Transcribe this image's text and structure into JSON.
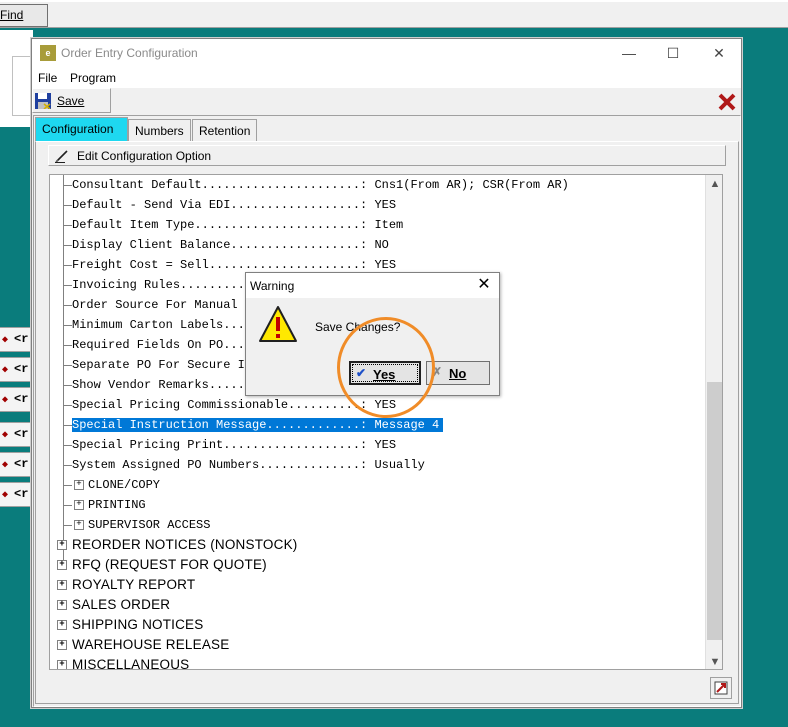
{
  "background_app": {
    "find_label": "Find",
    "side_button_label": "<r"
  },
  "window": {
    "title": "Order Entry Configuration",
    "icon_text": "e",
    "controls": {
      "minimize": "—",
      "maximize": "☐",
      "close": "✕"
    },
    "menu": [
      "File",
      "Program"
    ],
    "save_label": "Save"
  },
  "tabs": [
    "Configuration",
    "Numbers",
    "Retention"
  ],
  "edit_option_label": "Edit Configuration Option",
  "tree": {
    "items": [
      "Consultant Default......................: Cns1(From AR); CSR(From AR)",
      "Default - Send Via EDI..................: YES",
      "Default Item Type.......................: Item",
      "Display Client Balance..................: NO",
      "Freight Cost = Sell.....................: YES",
      "Invoicing Rules.........",
      "Order Source For Manual E",
      "Minimum Carton Labels....",
      "Required Fields On PO....",
      "Separate PO For Secure It",
      "Show Vendor Remarks......",
      "Special Pricing Commissionable..........: YES",
      "Special Instruction Message.............: Message 4",
      "Special Pricing Print...................: YES",
      "System Assigned PO Numbers..............: Usually"
    ],
    "selected_index": 12,
    "subgroups": [
      "CLONE/COPY",
      "PRINTING",
      "SUPERVISOR ACCESS"
    ],
    "categories": [
      "REORDER NOTICES (NONSTOCK)",
      "RFQ (REQUEST FOR QUOTE)",
      "ROYALTY REPORT",
      "SALES ORDER",
      "SHIPPING NOTICES",
      "WAREHOUSE RELEASE",
      "MISCELLANEOUS"
    ]
  },
  "dialog": {
    "title": "Warning",
    "close": "✕",
    "message": "Save Changes?",
    "yes_label": "Yes",
    "no_label": "No",
    "check": "✔",
    "x_mark": "✗"
  },
  "colors": {
    "desktop": "#0a7c7c",
    "tab_active": "#1ed8f0",
    "selection": "#0078d7",
    "highlight_circle": "#f08c28"
  }
}
